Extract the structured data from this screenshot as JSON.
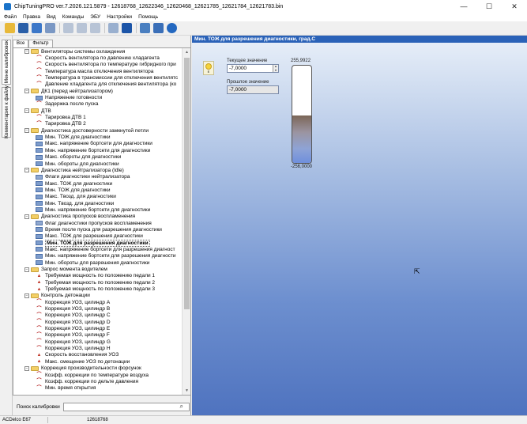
{
  "window": {
    "title": "ChipTuningPRO ver.7.2026.121.5879 - 12618768_12622346_12620468_12621785_12621784_12621783.bin",
    "minimize": "—",
    "maximize": "☐",
    "close": "✕"
  },
  "menu": [
    "Файл",
    "Правка",
    "Вид",
    "Команды",
    "ЭБУ",
    "Настройки",
    "Помощь"
  ],
  "side_tabs": {
    "maps": "Меню калибровок",
    "comments": "Комментарии к файлу"
  },
  "tabs": {
    "all": "Все",
    "filter": "Фильтр"
  },
  "tree": [
    {
      "level": 1,
      "type": "folder",
      "label": "Вентиляторы системы охлаждения"
    },
    {
      "level": 2,
      "type": "curve",
      "label": "Скорость вентилятора по давлению хладагента"
    },
    {
      "level": 2,
      "type": "curve",
      "label": "Скорость вентилятора по температуре гибридного при"
    },
    {
      "level": 2,
      "type": "curve",
      "label": "Температура масла отключения вентилятора"
    },
    {
      "level": 2,
      "type": "curve",
      "label": "Температура в трансмиссии для отключения вентилятс"
    },
    {
      "level": 2,
      "type": "curve",
      "label": "Давление хладагента для отключения вентилятора (ко"
    },
    {
      "level": 1,
      "type": "folder",
      "label": "ДК1 (перед нейтрализатором)"
    },
    {
      "level": 2,
      "type": "scalar",
      "label": "Напряжение готовности"
    },
    {
      "level": 2,
      "type": "curve",
      "label": "Задержка после пуска"
    },
    {
      "level": 1,
      "type": "folder",
      "label": "ДТВ"
    },
    {
      "level": 2,
      "type": "curve",
      "label": "Тарировка ДТВ 1"
    },
    {
      "level": 2,
      "type": "curve",
      "label": "Тарировка ДТВ 2"
    },
    {
      "level": 1,
      "type": "folder",
      "label": "Диагностика достоверности замкнутой петли"
    },
    {
      "level": 2,
      "type": "scalar",
      "label": "Мин. ТОЖ для диагностики"
    },
    {
      "level": 2,
      "type": "scalar",
      "label": "Макс. напряжение бортсети для диагностики"
    },
    {
      "level": 2,
      "type": "scalar",
      "label": "Мин. напряжение бортсети для диагностики"
    },
    {
      "level": 2,
      "type": "scalar",
      "label": "Макс. обороты для диагностики"
    },
    {
      "level": 2,
      "type": "scalar",
      "label": "Мин. обороты для диагностики"
    },
    {
      "level": 1,
      "type": "folder",
      "label": "Диагностика нейтрализатора (Idle)"
    },
    {
      "level": 2,
      "type": "flag",
      "label": "Флаги диагностики нейтрализатора"
    },
    {
      "level": 2,
      "type": "scalar",
      "label": "Макс. ТОЖ для диагностики"
    },
    {
      "level": 2,
      "type": "scalar",
      "label": "Мин. ТОЖ для диагностики"
    },
    {
      "level": 2,
      "type": "scalar",
      "label": "Макс. Tвозд. для диагностики"
    },
    {
      "level": 2,
      "type": "scalar",
      "label": "Мин. Tвозд. для диагностики"
    },
    {
      "level": 2,
      "type": "scalar",
      "label": "Мин. напряжение бортсети для диагностики"
    },
    {
      "level": 1,
      "type": "folder",
      "label": "Диагностика пропусков воспламенения"
    },
    {
      "level": 2,
      "type": "flag",
      "label": "Флаг диагностики пропусков воспламенения"
    },
    {
      "level": 2,
      "type": "scalar",
      "label": "Время после пуска для разрешения диагностики"
    },
    {
      "level": 2,
      "type": "scalar",
      "label": "Макс. ТОЖ для разрешения диагностики"
    },
    {
      "level": 2,
      "type": "scalar",
      "label": "Мин. ТОЖ для разрешения диагностики",
      "selected": true
    },
    {
      "level": 2,
      "type": "scalar",
      "label": "Макс. напряжение бортсети для разрешения диагност"
    },
    {
      "level": 2,
      "type": "scalar",
      "label": "Мин. напряжение бортсети для разрешения диагности"
    },
    {
      "level": 2,
      "type": "scalar",
      "label": "Мин. обороты для разрешения диагностики"
    },
    {
      "level": 1,
      "type": "folder",
      "label": "Запрос момента водителем"
    },
    {
      "level": 2,
      "type": "map",
      "label": "Требуемая мощность по положению педали 1"
    },
    {
      "level": 2,
      "type": "map",
      "label": "Требуемая мощность по положению педали 2"
    },
    {
      "level": 2,
      "type": "map",
      "label": "Требуемая мощность по положению педали 3"
    },
    {
      "level": 1,
      "type": "folder",
      "label": "Контроль детонации"
    },
    {
      "level": 2,
      "type": "curve",
      "label": "Коррекция УОЗ, цилиндр A"
    },
    {
      "level": 2,
      "type": "curve",
      "label": "Коррекция УОЗ, цилиндр B"
    },
    {
      "level": 2,
      "type": "curve",
      "label": "Коррекция УОЗ, цилиндр C"
    },
    {
      "level": 2,
      "type": "curve",
      "label": "Коррекция УОЗ, цилиндр D"
    },
    {
      "level": 2,
      "type": "curve",
      "label": "Коррекция УОЗ, цилиндр E"
    },
    {
      "level": 2,
      "type": "curve",
      "label": "Коррекция УОЗ, цилиндр F"
    },
    {
      "level": 2,
      "type": "curve",
      "label": "Коррекция УОЗ, цилиндр G"
    },
    {
      "level": 2,
      "type": "curve",
      "label": "Коррекция УОЗ, цилиндр H"
    },
    {
      "level": 2,
      "type": "map",
      "label": "Скорость восстановления УОЗ"
    },
    {
      "level": 2,
      "type": "map",
      "label": "Макс. смещение УОЗ по детонации"
    },
    {
      "level": 1,
      "type": "folder",
      "label": "Коррекция производительности форсунок"
    },
    {
      "level": 2,
      "type": "curve",
      "label": "Коэфф. коррекции по температуре воздуха"
    },
    {
      "level": 2,
      "type": "curve",
      "label": "Коэфф. коррекции по дельте давления"
    },
    {
      "level": 2,
      "type": "curve",
      "label": "Мин. время открытия"
    }
  ],
  "search": {
    "label": "Поиск калибровки",
    "value": ""
  },
  "panel": {
    "header": "Мин. ТОЖ для разрешения диагностики, град.С",
    "bulb_label": "E",
    "current_label": "Текущее значение",
    "current_value": "-7,0000",
    "previous_label": "Прошлое значение",
    "previous_value": "-7,0000",
    "gauge_max": "255,9922",
    "gauge_min": "-256,0000",
    "gauge_fill_fraction": 0.49
  },
  "status": {
    "ecu": "ACDelco E67",
    "id": "12618768"
  }
}
